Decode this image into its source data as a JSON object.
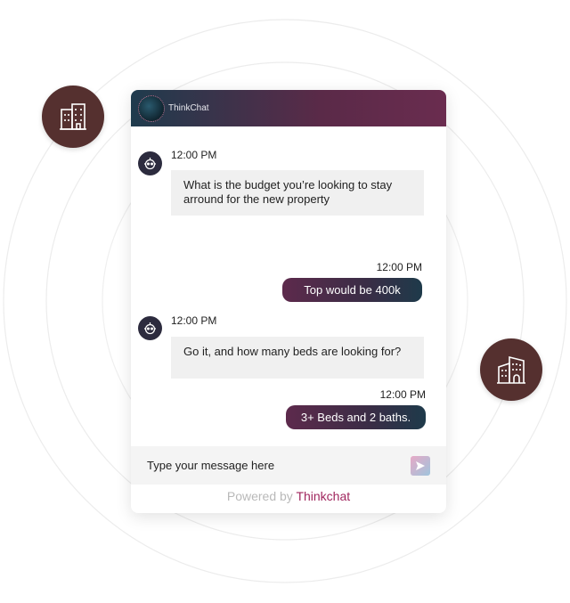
{
  "header": {
    "title": "ThinkChat"
  },
  "messages": [
    {
      "sender": "bot",
      "time": "12:00 PM",
      "text": "What is the budget you’re looking to stay arround for the new property"
    },
    {
      "sender": "user",
      "time": "12:00 PM",
      "text": "Top would be 400k"
    },
    {
      "sender": "bot",
      "time": "12:00 PM",
      "text": "Go it, and how many beds are looking for?"
    },
    {
      "sender": "user",
      "time": "12:00 PM",
      "text": "3+ Beds and 2 baths."
    }
  ],
  "composer": {
    "placeholder": "Type your message here"
  },
  "footer": {
    "powered_by": "Powered by",
    "brand": "Thinkchat"
  },
  "icons": {
    "left_badge": "office-building-icon",
    "right_badge": "apartment-building-icon",
    "bot_avatar": "robot-icon",
    "send": "send-icon"
  },
  "colors": {
    "header_start": "#1f3b4d",
    "header_end": "#6a2c4f",
    "badge": "#55302f",
    "brand": "#a0265e"
  }
}
